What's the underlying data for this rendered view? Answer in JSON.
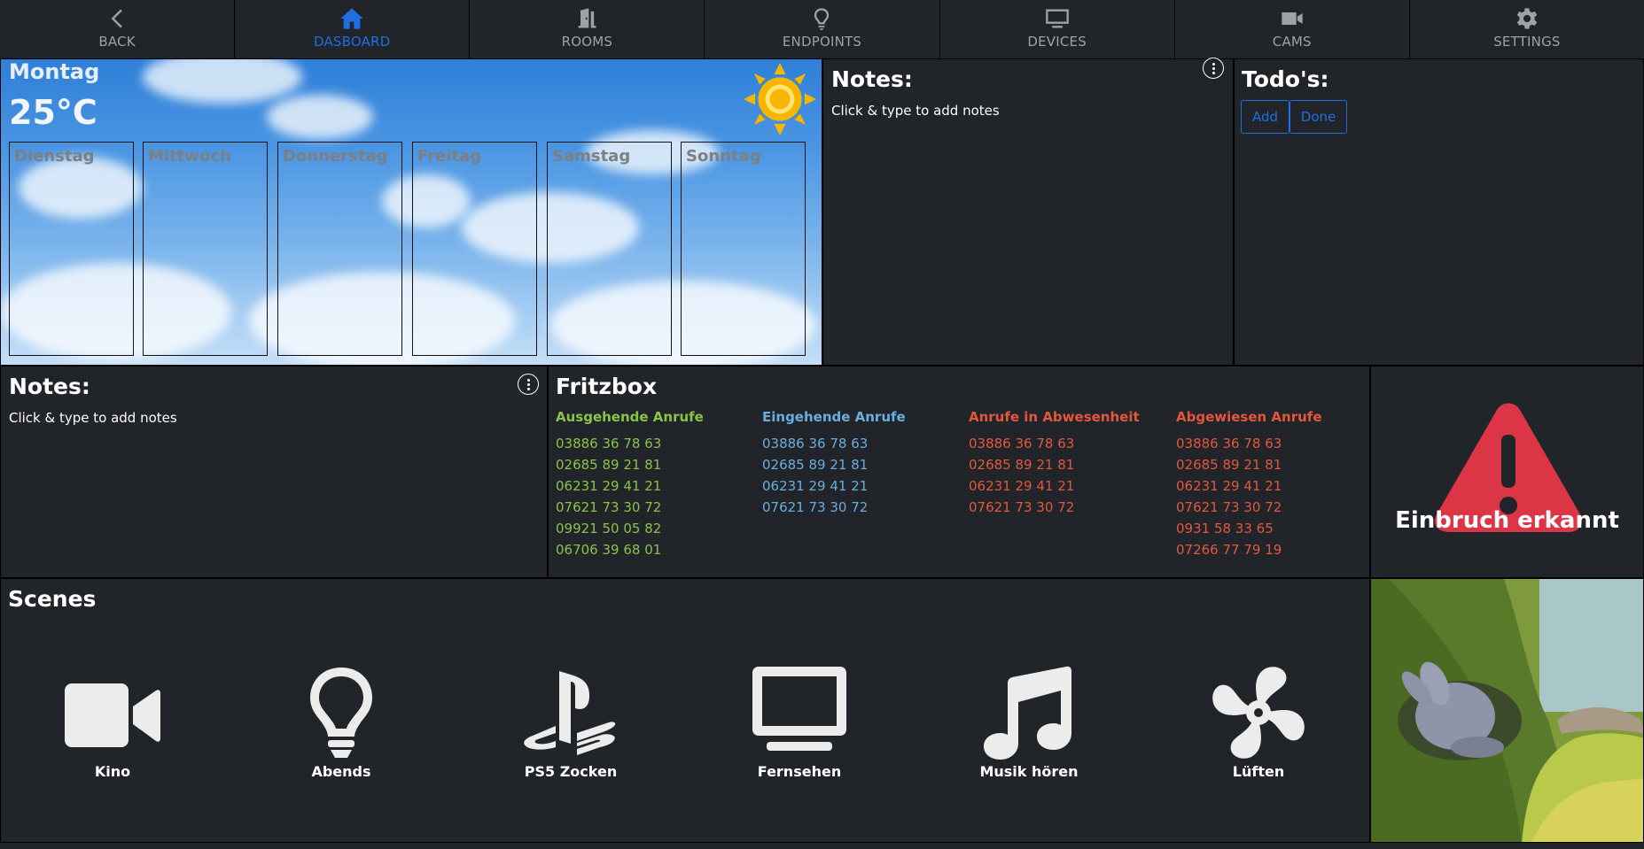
{
  "nav": [
    {
      "label": "BACK",
      "icon": "chevron-left-icon",
      "active": false
    },
    {
      "label": "DASBOARD",
      "icon": "home-icon",
      "active": true
    },
    {
      "label": "ROOMS",
      "icon": "door-icon",
      "active": false
    },
    {
      "label": "ENDPOINTS",
      "icon": "lightbulb-icon",
      "active": false
    },
    {
      "label": "DEVICES",
      "icon": "monitor-icon",
      "active": false
    },
    {
      "label": "CAMS",
      "icon": "camera-icon",
      "active": false
    },
    {
      "label": "SETTINGS",
      "icon": "gear-icon",
      "active": false
    }
  ],
  "weather": {
    "today": "Montag",
    "temperature": "25°C",
    "days": [
      "Dienstag",
      "Mittwoch",
      "Donnerstag",
      "Freitag",
      "Samstag",
      "Sonntag"
    ]
  },
  "notes_top": {
    "title": "Notes:",
    "text": "Click & type to add notes"
  },
  "todo": {
    "title": "Todo's:",
    "add": "Add",
    "done": "Done"
  },
  "notes_left": {
    "title": "Notes:",
    "text": "Click & type to add notes"
  },
  "fritzbox": {
    "title": "Fritzbox",
    "columns": [
      {
        "heading": "Ausgehende Anrufe",
        "color": "#8bc34a",
        "numbers": [
          "03886 36 78 63",
          "02685 89 21 81",
          "06231 29 41 21",
          "07621 73 30 72",
          "09921 50 05 82",
          "06706 39 68 01"
        ]
      },
      {
        "heading": "Eingehende Anrufe",
        "color": "#6aaee0",
        "numbers": [
          "03886 36 78 63",
          "02685 89 21 81",
          "06231 29 41 21",
          "07621 73 30 72"
        ]
      },
      {
        "heading": "Anrufe in Abwesenheit",
        "color": "#e4573f",
        "numbers": [
          "03886 36 78 63",
          "02685 89 21 81",
          "06231 29 41 21",
          "07621 73 30 72"
        ]
      },
      {
        "heading": "Abgewiesen Anrufe",
        "color": "#e4573f",
        "numbers": [
          "03886 36 78 63",
          "02685 89 21 81",
          "06231 29 41 21",
          "07621 73 30 72",
          "0931 58 33 65",
          "07266 77 79 19"
        ]
      }
    ]
  },
  "alarm": {
    "text": "Einbruch erkannt",
    "color": "#dc3545"
  },
  "scenes": {
    "title": "Scenes",
    "items": [
      {
        "label": "Kino",
        "icon": "video-camera-icon"
      },
      {
        "label": "Abends",
        "icon": "lightbulb-icon"
      },
      {
        "label": "PS5 Zocken",
        "icon": "playstation-icon"
      },
      {
        "label": "Fernsehen",
        "icon": "tv-icon"
      },
      {
        "label": "Musik hören",
        "icon": "music-icon"
      },
      {
        "label": "Lüften",
        "icon": "fan-icon"
      }
    ]
  }
}
